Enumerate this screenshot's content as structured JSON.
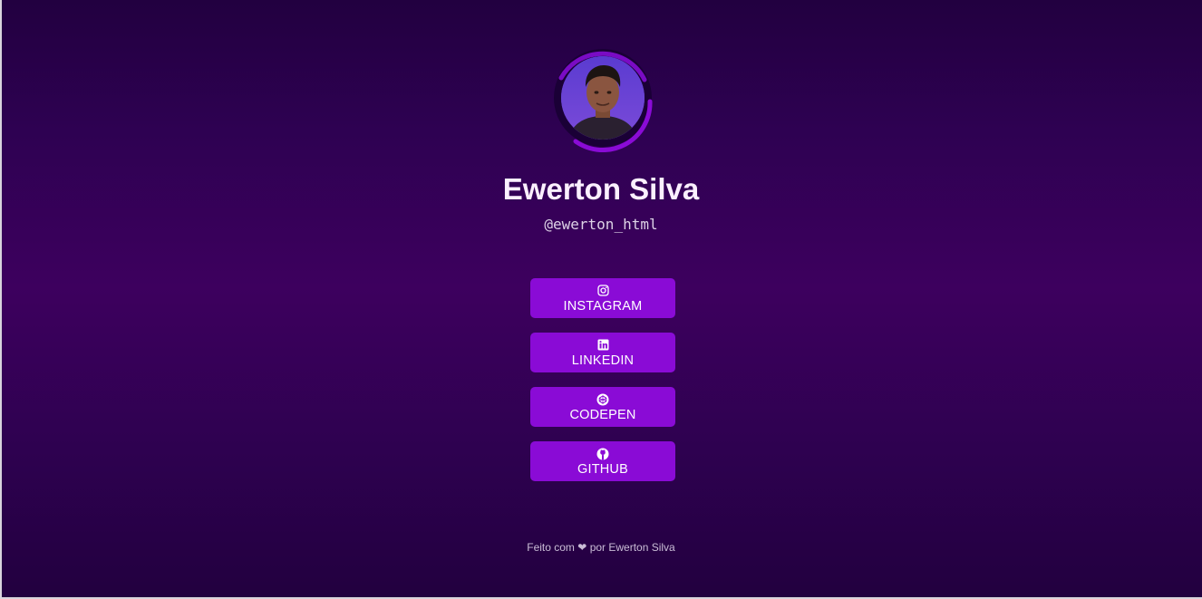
{
  "profile": {
    "name": "Ewerton Silva",
    "handle": "@ewerton_html"
  },
  "links": [
    {
      "label": "INSTAGRAM",
      "icon": "instagram-icon"
    },
    {
      "label": "LINKEDIN",
      "icon": "linkedin-icon"
    },
    {
      "label": "CODEPEN",
      "icon": "codepen-icon"
    },
    {
      "label": "GITHUB",
      "icon": "github-icon"
    }
  ],
  "footer": {
    "prefix": "Feito com",
    "heart": "❤",
    "suffix": "por Ewerton Silva"
  },
  "colors": {
    "background_top": "#220040",
    "background_mid": "#3d005e",
    "button": "#8a0bd6",
    "ring": "#8a0bd6"
  }
}
